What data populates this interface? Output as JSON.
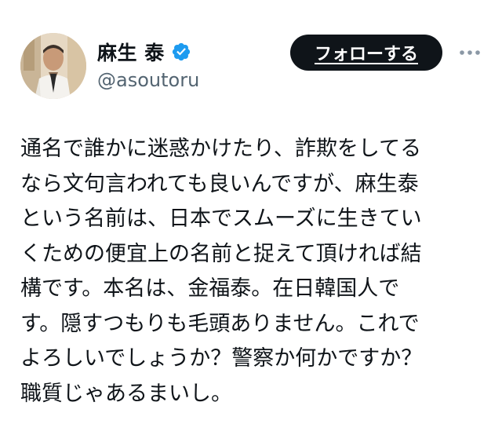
{
  "author": {
    "display_name": "麻生 泰",
    "handle": "@asoutoru",
    "verified": true
  },
  "actions": {
    "follow_label": "フォローする",
    "more_icon": "more-horizontal-icon"
  },
  "tweet": {
    "lines": [
      "通名で誰かに迷惑かけたり、詐欺をしてる",
      "なら文句言われても良いんですが、麻生泰",
      "という名前は、日本でスムーズに生きてい",
      "くための便宜上の名前と捉えて頂ければ結",
      "構です。本名は、金福泰。在日韓国人で",
      "す。隠すつもりも毛頭ありません。これで",
      "よろしいでしょうか？警察か何かですか？",
      "職質じゃあるまいし。"
    ]
  },
  "colors": {
    "text": "#0f1419",
    "secondary": "#536471",
    "verified_badge": "#1d9bf0",
    "button_bg": "#0f1419",
    "button_text": "#ffffff"
  }
}
